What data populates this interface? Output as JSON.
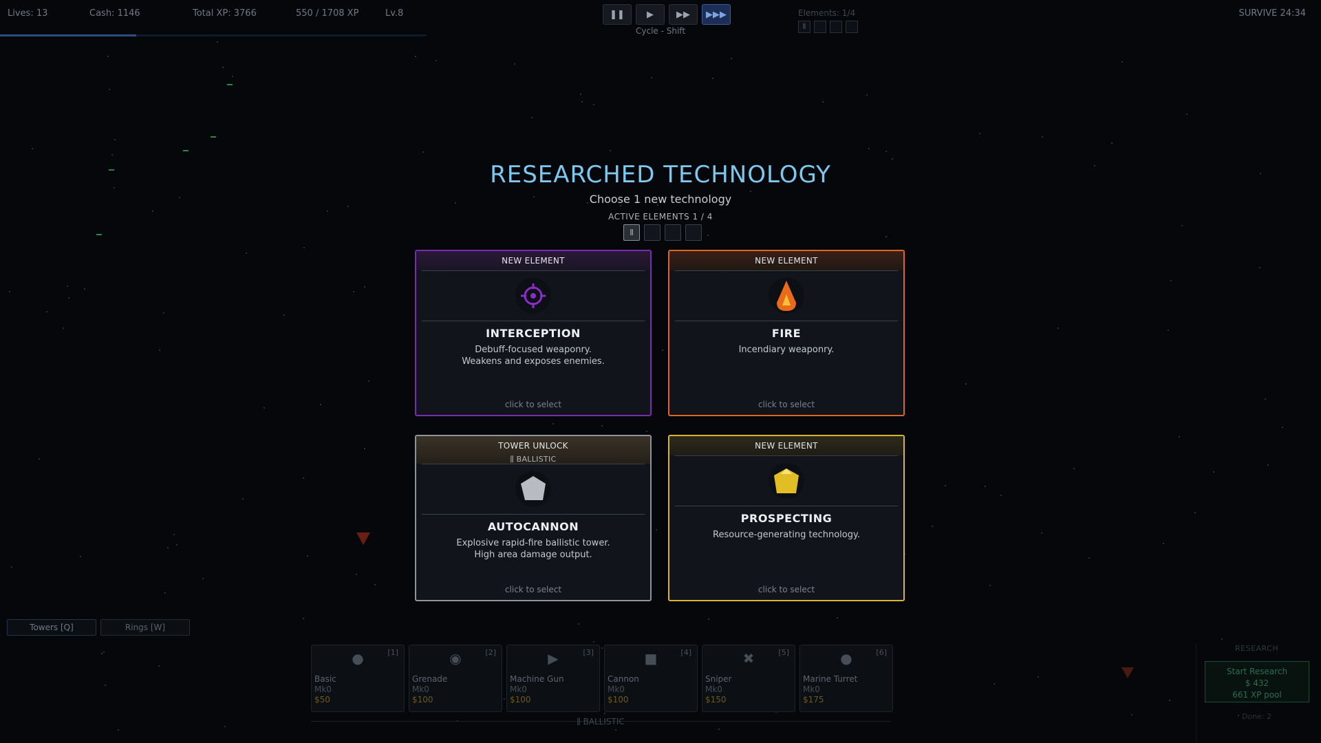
{
  "hud": {
    "lives": "Lives: 13",
    "cash": "Cash: 1146",
    "total_xp": "Total XP: 3766",
    "xp_progress": "550 / 1708 XP",
    "level": "Lv.8",
    "xp_fraction": 0.32,
    "cycle_hint": "Cycle - Shift",
    "elements": "Elements: 1/4",
    "survive": "SURVIVE  24:34"
  },
  "speed_controls": {
    "pause": "❚❚",
    "play": "▶",
    "fast": "▶▶",
    "fastest": "▶▶▶"
  },
  "overlay": {
    "title": "RESEARCHED TECHNOLOGY",
    "subtitle": "Choose 1 new technology",
    "active_elements": "ACTIVE ELEMENTS  1 / 4",
    "active_slot_glyph": "⫼",
    "cards": [
      {
        "header": "NEW ELEMENT",
        "icon": "crosshair-icon",
        "name": "INTERCEPTION",
        "desc1": "Debuff-focused weaponry.",
        "desc2": "Weakens and exposes enemies.",
        "foot": "click to select",
        "color": "#7a2bb0"
      },
      {
        "header": "NEW ELEMENT",
        "icon": "flame-icon",
        "name": "FIRE",
        "desc1": "Incendiary weaponry.",
        "desc2": "",
        "foot": "click to select",
        "color": "#e0651e"
      },
      {
        "header": "TOWER UNLOCK",
        "subheader": "⫼ BALLISTIC",
        "icon": "hexagon-icon",
        "name": "AUTOCANNON",
        "desc1": "Explosive rapid-fire ballistic tower.",
        "desc2": "High area damage output.",
        "foot": "click to select",
        "color": "#8d949c"
      },
      {
        "header": "NEW ELEMENT",
        "icon": "gem-icon",
        "name": "PROSPECTING",
        "desc1": "Resource-generating technology.",
        "desc2": "",
        "foot": "click to select",
        "color": "#d9b62c"
      }
    ]
  },
  "tabs": {
    "towers": "Towers [Q]",
    "rings": "Rings [W]"
  },
  "towers": [
    {
      "key": "[1]",
      "name": "Basic",
      "mk": "Mk0",
      "cost": "$50",
      "icon": "●"
    },
    {
      "key": "[2]",
      "name": "Grenade",
      "mk": "Mk0",
      "cost": "$100",
      "icon": "◉"
    },
    {
      "key": "[3]",
      "name": "Machine Gun",
      "mk": "Mk0",
      "cost": "$100",
      "icon": "▶"
    },
    {
      "key": "[4]",
      "name": "Cannon",
      "mk": "Mk0",
      "cost": "$100",
      "icon": "■"
    },
    {
      "key": "[5]",
      "name": "Sniper",
      "mk": "Mk0",
      "cost": "$150",
      "icon": "✖"
    },
    {
      "key": "[6]",
      "name": "Marine Turret",
      "mk": "Mk0",
      "cost": "$175",
      "icon": "●"
    }
  ],
  "tower_category": "⫼ BALLISTIC",
  "research": {
    "title": "RESEARCH",
    "button": "Start Research",
    "cost": "$ 432",
    "pool": "661 XP pool",
    "done": "Done: 2"
  }
}
